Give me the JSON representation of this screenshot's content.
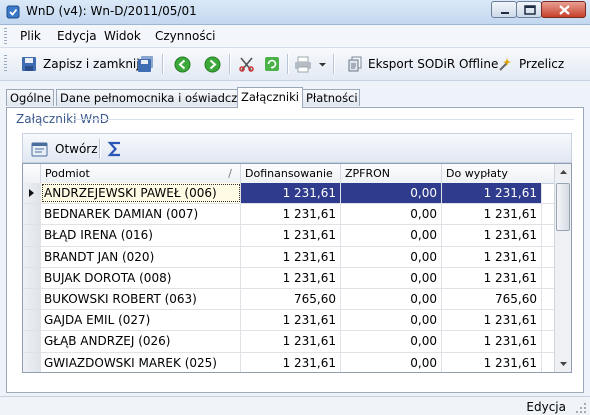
{
  "window": {
    "title": "WnD (v4): Wn-D/2011/05/01",
    "controls": [
      "minimize",
      "maximize",
      "close"
    ]
  },
  "menu": {
    "items": [
      {
        "label": "Plik"
      },
      {
        "label": "Edycja"
      },
      {
        "label": "Widok"
      },
      {
        "label": "Czynności"
      }
    ]
  },
  "toolbar": {
    "save_close": "Zapisz i zamknij",
    "export": "Eksport SODiR Offline",
    "recalc": "Przelicz",
    "icons": [
      "save-disk-icon",
      "save-disk-icon",
      "back-arrow-icon",
      "forward-arrow-icon",
      "scissors-icon",
      "refresh-icon",
      "printer-icon",
      "export-icon",
      "recalc-icon"
    ]
  },
  "tabs": [
    {
      "label": "Ogólne",
      "active": false
    },
    {
      "label": "Dane pełnomocnika i oświadczenia",
      "active": false
    },
    {
      "label": "Załączniki",
      "active": true
    },
    {
      "label": "Płatności",
      "active": false
    }
  ],
  "group": {
    "title": "Załączniki WnD"
  },
  "inner_toolbar": {
    "open": "Otwórz",
    "sum_icon": "sigma-icon"
  },
  "grid": {
    "columns": [
      "Podmiot",
      "Dofinansowanie",
      "ZPFRON",
      "Do wypłaty"
    ],
    "sort_indicator": "/",
    "rows": [
      {
        "podmiot": "ANDRZEJEWSKI PAWEŁ (006)",
        "dof": "1 231,61",
        "zpf": "0,00",
        "wyp": "1 231,61",
        "selected": true
      },
      {
        "podmiot": "BEDNAREK DAMIAN (007)",
        "dof": "1 231,61",
        "zpf": "0,00",
        "wyp": "1 231,61"
      },
      {
        "podmiot": "BŁĄD IRENA (016)",
        "dof": "1 231,61",
        "zpf": "0,00",
        "wyp": "1 231,61"
      },
      {
        "podmiot": "BRANDT JAN (020)",
        "dof": "1 231,61",
        "zpf": "0,00",
        "wyp": "1 231,61"
      },
      {
        "podmiot": "BUJAK DOROTA (008)",
        "dof": "1 231,61",
        "zpf": "0,00",
        "wyp": "1 231,61"
      },
      {
        "podmiot": "BUKOWSKI ROBERT (063)",
        "dof": "765,60",
        "zpf": "0,00",
        "wyp": "765,60"
      },
      {
        "podmiot": "GAJDA EMIL (027)",
        "dof": "1 231,61",
        "zpf": "0,00",
        "wyp": "1 231,61"
      },
      {
        "podmiot": "GŁĄB ANDRZEJ (026)",
        "dof": "1 231,61",
        "zpf": "0,00",
        "wyp": "1 231,61"
      },
      {
        "podmiot": "GWIAZDOWSKI MAREK (025)",
        "dof": "1 231,61",
        "zpf": "0,00",
        "wyp": "1 231,61"
      }
    ]
  },
  "status": {
    "mode": "Edycja"
  },
  "colors": {
    "selection": "#2f3c8e",
    "selected_cell": "#fffbe5",
    "accent": "#3a5a8c"
  }
}
